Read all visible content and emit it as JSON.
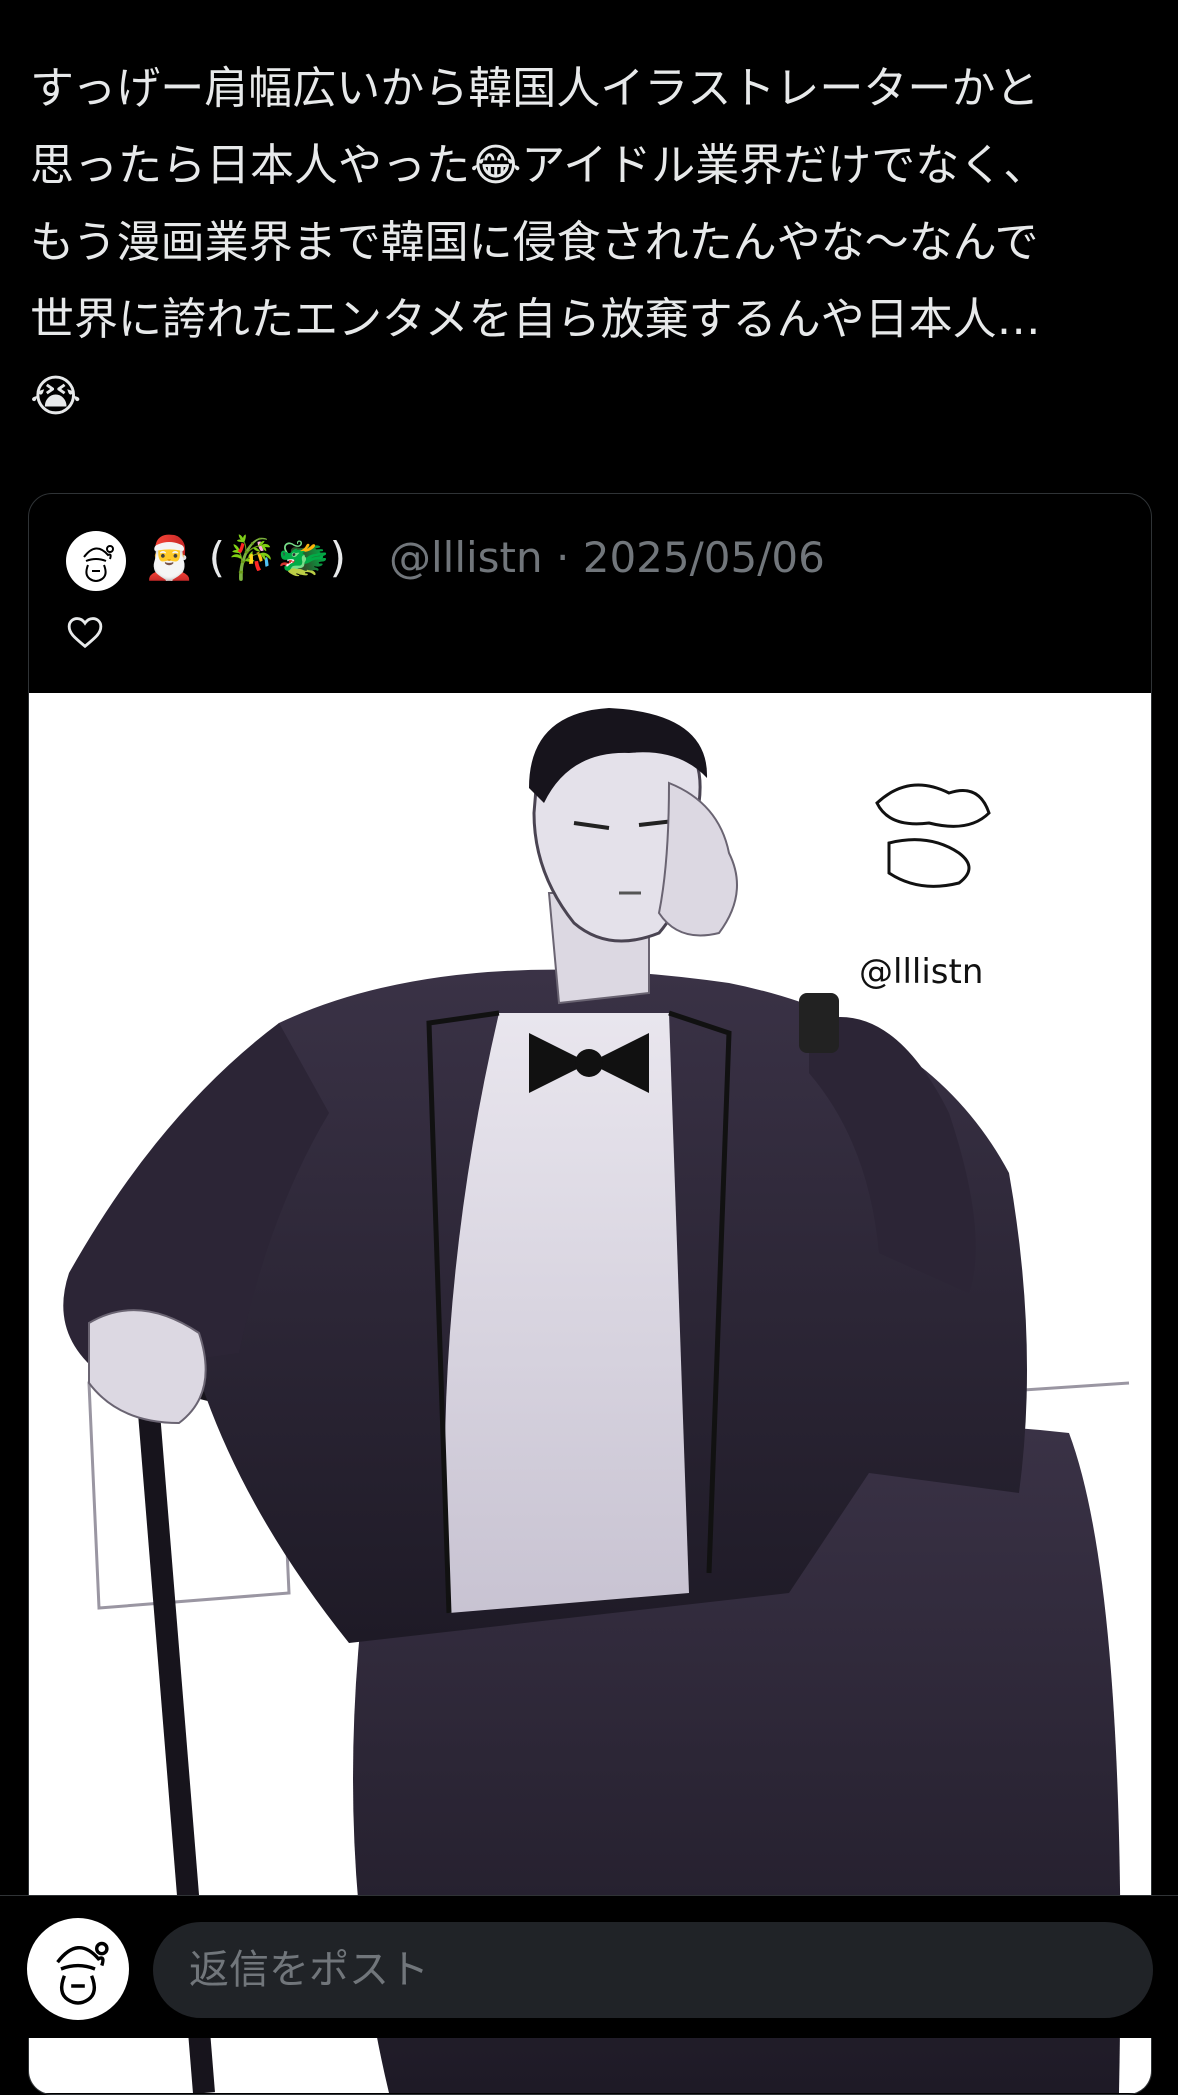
{
  "post": {
    "text_lines": [
      "すっげー肩幅広いから韓国人イラストレーターかと",
      "思ったら日本人やった😂アイドル業界だけでなく、",
      "もう漫画業界まで韓国に侵食されたんやな〜なんで",
      "世界に誇れたエンタメを自ら放棄するんや日本人…",
      "😭"
    ]
  },
  "quote": {
    "display_name": "🎅 (🎋🐲)",
    "handle": "@lllistn",
    "separator": "·",
    "date": "2025/05/06",
    "like_icon": "heart-outline-icon",
    "artwork_signature": "@lllistn"
  },
  "reply": {
    "placeholder": "返信をポスト"
  },
  "colors": {
    "background": "#000000",
    "text": "#e7e9ea",
    "muted": "#71767b",
    "input_bg": "#202327"
  }
}
